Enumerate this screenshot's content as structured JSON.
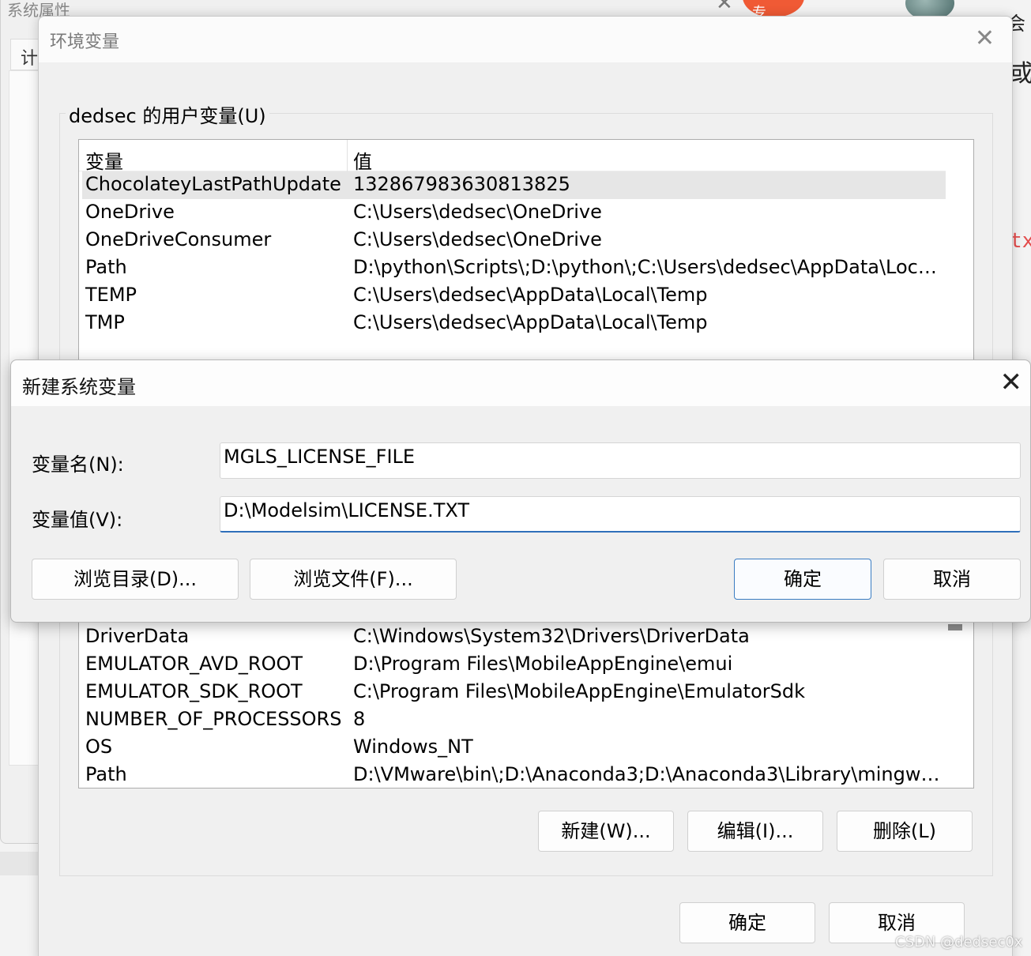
{
  "background": {
    "sysprop_title": "系统属性",
    "sysprop_close": "✕",
    "sysprop_tab": "计",
    "badge_text": "专",
    "right_text_1": "会",
    "right_text_2": "或",
    "right_code": "tx"
  },
  "env_window": {
    "title": "环境变量",
    "close": "✕",
    "user_group_label": "dedsec 的用户变量(U)",
    "columns": [
      "变量",
      "值"
    ],
    "user_vars": [
      {
        "name": "ChocolateyLastPathUpdate",
        "value": "132867983630813825"
      },
      {
        "name": "OneDrive",
        "value": "C:\\Users\\dedsec\\OneDrive"
      },
      {
        "name": "OneDriveConsumer",
        "value": "C:\\Users\\dedsec\\OneDrive"
      },
      {
        "name": "Path",
        "value": "D:\\python\\Scripts\\;D:\\python\\;C:\\Users\\dedsec\\AppData\\Local\\..."
      },
      {
        "name": "TEMP",
        "value": "C:\\Users\\dedsec\\AppData\\Local\\Temp"
      },
      {
        "name": "TMP",
        "value": "C:\\Users\\dedsec\\AppData\\Local\\Temp"
      }
    ],
    "system_vars": [
      {
        "name": "DriverData",
        "value": "C:\\Windows\\System32\\Drivers\\DriverData"
      },
      {
        "name": "EMULATOR_AVD_ROOT",
        "value": "D:\\Program Files\\MobileAppEngine\\emui"
      },
      {
        "name": "EMULATOR_SDK_ROOT",
        "value": "C:\\Program Files\\MobileAppEngine\\EmulatorSdk"
      },
      {
        "name": "NUMBER_OF_PROCESSORS",
        "value": "8"
      },
      {
        "name": "OS",
        "value": "Windows_NT"
      },
      {
        "name": "Path",
        "value": "D:\\VMware\\bin\\;D:\\Anaconda3;D:\\Anaconda3\\Library\\mingw-w..."
      }
    ],
    "sys_buttons": {
      "new": "新建(W)...",
      "edit": "编辑(I)...",
      "delete": "删除(L)"
    },
    "ok": "确定",
    "cancel": "取消"
  },
  "new_dialog": {
    "title": "新建系统变量",
    "close": "✕",
    "name_label": "变量名(N):",
    "name_value": "MGLS_LICENSE_FILE",
    "value_label": "变量值(V):",
    "value_value": "D:\\Modelsim\\LICENSE.TXT",
    "browse_dir": "浏览目录(D)...",
    "browse_file": "浏览文件(F)...",
    "ok": "确定",
    "cancel": "取消"
  },
  "watermark": "CSDN @dedsec0x"
}
